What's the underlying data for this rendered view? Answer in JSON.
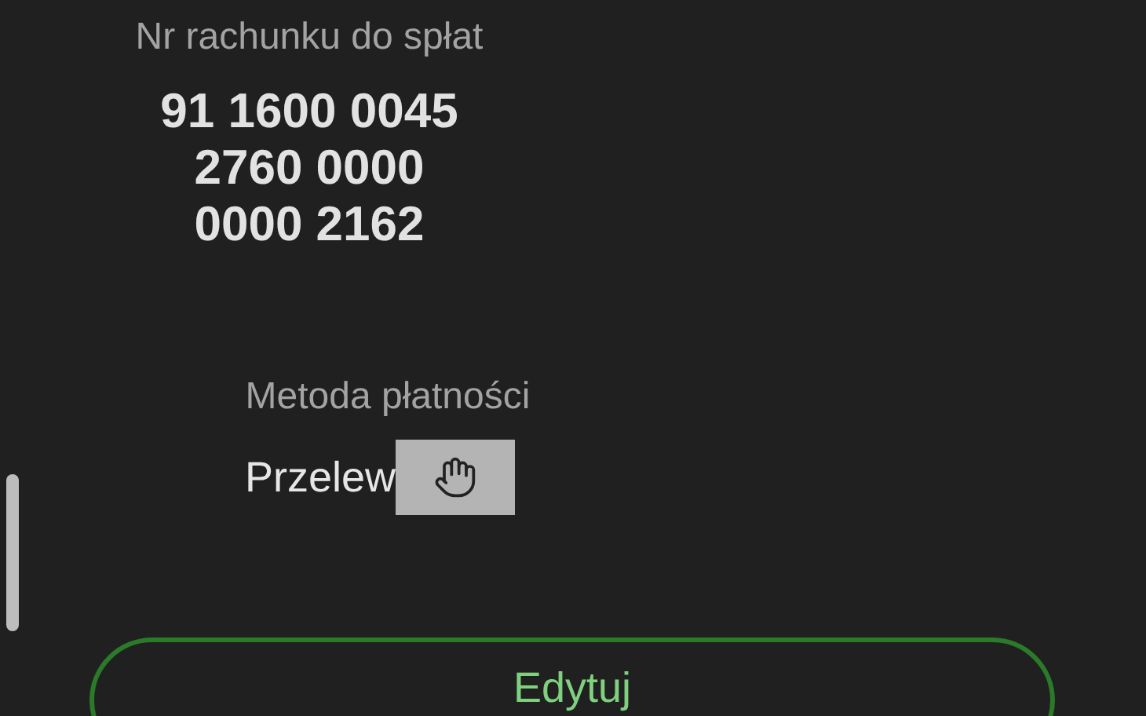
{
  "account": {
    "label": "Nr rachunku do spłat",
    "lines": [
      "91 1600 0045",
      "2760 0000",
      "0000 2162"
    ]
  },
  "payment": {
    "label": "Metoda płatności",
    "value": "Przelew"
  },
  "button": {
    "label": "Edytuj"
  }
}
